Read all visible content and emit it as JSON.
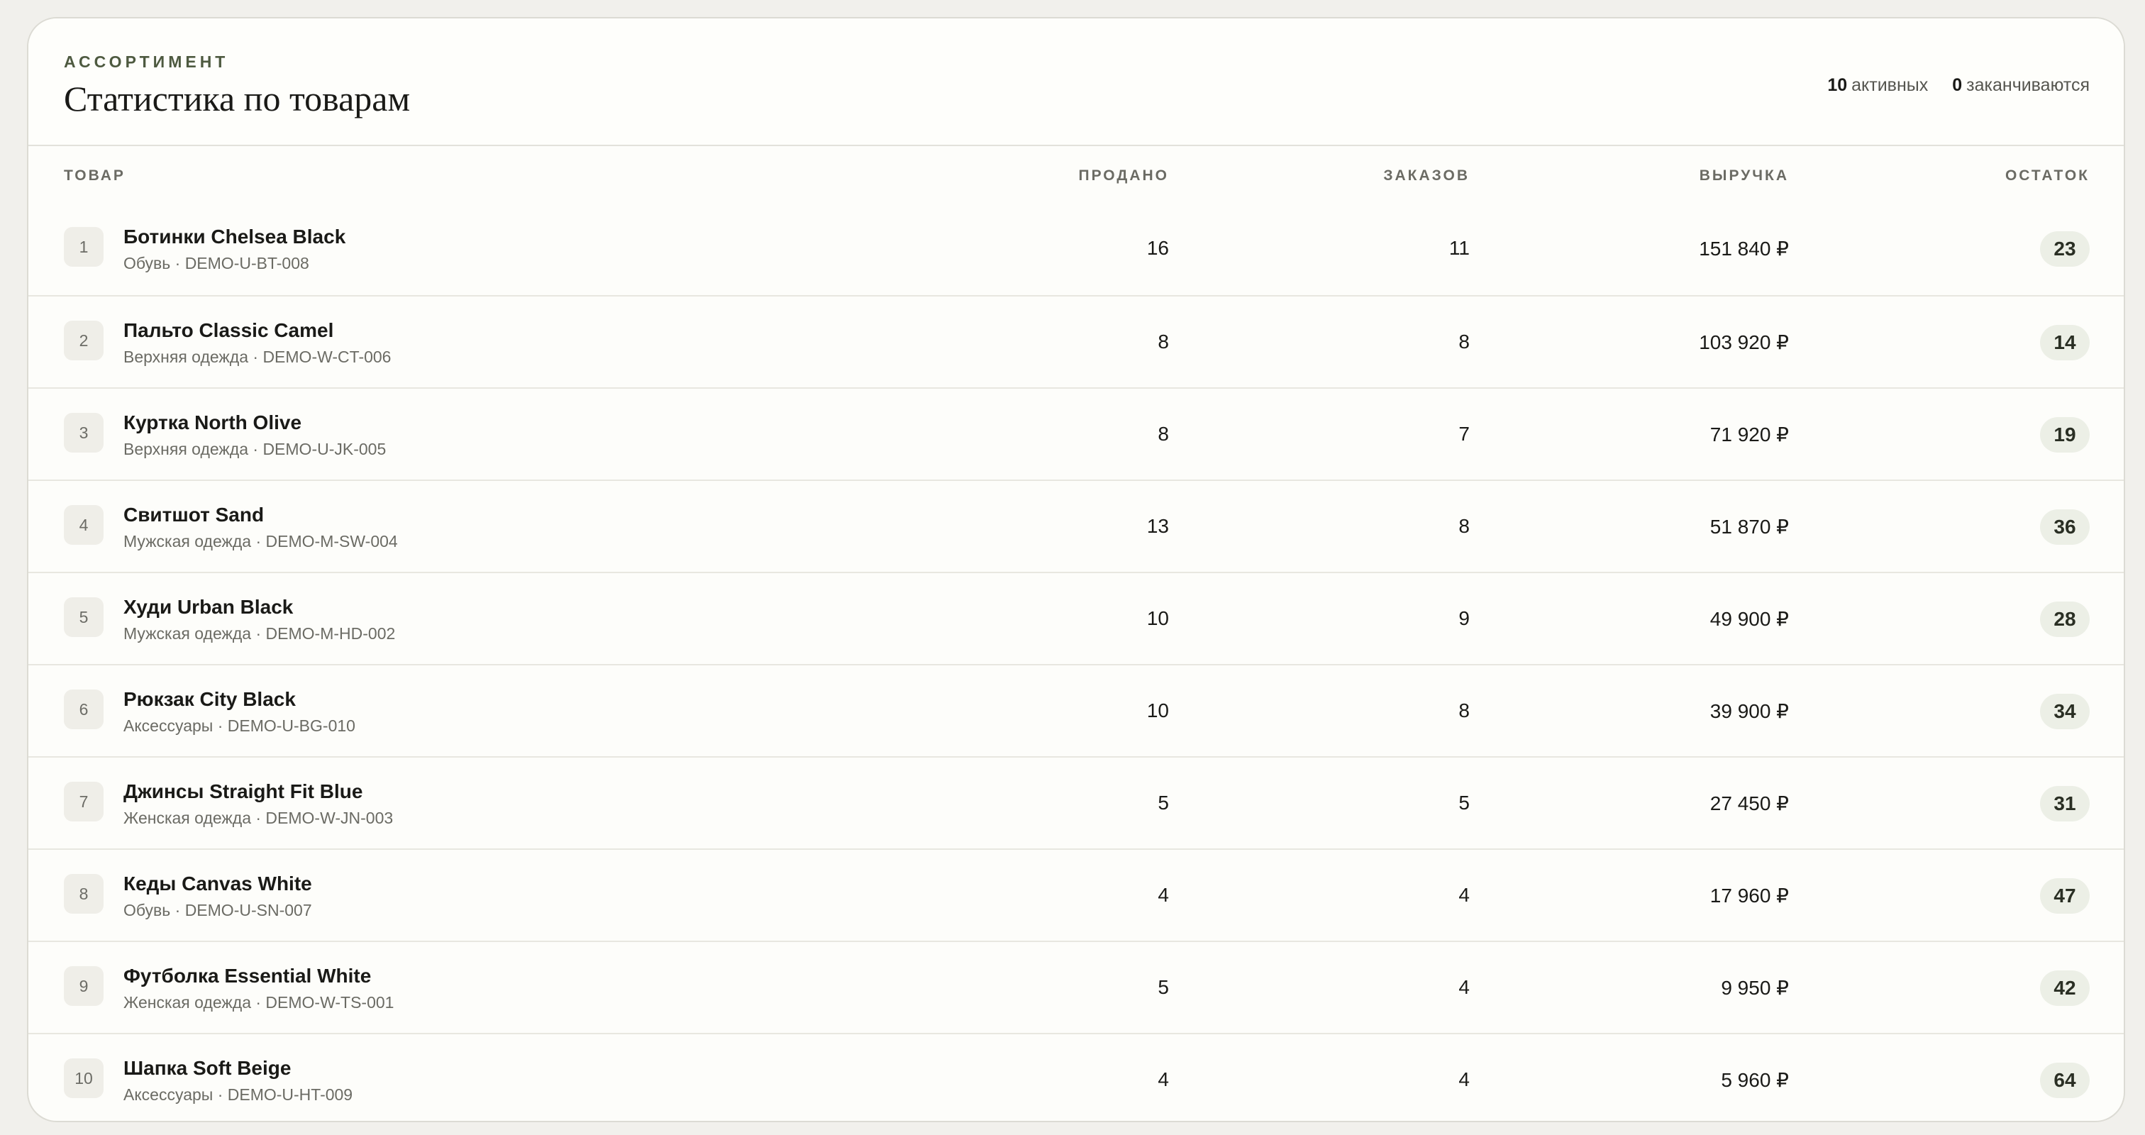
{
  "header": {
    "eyebrow": "АССОРТИМЕНТ",
    "title": "Статистика по товарам",
    "active_count": "10",
    "active_label": "активных",
    "low_count": "0",
    "low_label": "заканчиваются"
  },
  "columns": {
    "product": "ТОВАР",
    "sold": "ПРОДАНО",
    "orders": "ЗАКАЗОВ",
    "revenue": "ВЫРУЧКА",
    "stock": "ОСТАТОК"
  },
  "rows": [
    {
      "rank": "1",
      "name": "Ботинки Chelsea Black",
      "meta": "Обувь · DEMO-U-BT-008",
      "sold": "16",
      "orders": "11",
      "revenue": "151 840 ₽",
      "stock": "23"
    },
    {
      "rank": "2",
      "name": "Пальто Classic Camel",
      "meta": "Верхняя одежда · DEMO-W-CT-006",
      "sold": "8",
      "orders": "8",
      "revenue": "103 920 ₽",
      "stock": "14"
    },
    {
      "rank": "3",
      "name": "Куртка North Olive",
      "meta": "Верхняя одежда · DEMO-U-JK-005",
      "sold": "8",
      "orders": "7",
      "revenue": "71 920 ₽",
      "stock": "19"
    },
    {
      "rank": "4",
      "name": "Свитшот Sand",
      "meta": "Мужская одежда · DEMO-M-SW-004",
      "sold": "13",
      "orders": "8",
      "revenue": "51 870 ₽",
      "stock": "36"
    },
    {
      "rank": "5",
      "name": "Худи Urban Black",
      "meta": "Мужская одежда · DEMO-M-HD-002",
      "sold": "10",
      "orders": "9",
      "revenue": "49 900 ₽",
      "stock": "28"
    },
    {
      "rank": "6",
      "name": "Рюкзак City Black",
      "meta": "Аксессуары · DEMO-U-BG-010",
      "sold": "10",
      "orders": "8",
      "revenue": "39 900 ₽",
      "stock": "34"
    },
    {
      "rank": "7",
      "name": "Джинсы Straight Fit Blue",
      "meta": "Женская одежда · DEMO-W-JN-003",
      "sold": "5",
      "orders": "5",
      "revenue": "27 450 ₽",
      "stock": "31"
    },
    {
      "rank": "8",
      "name": "Кеды Canvas White",
      "meta": "Обувь · DEMO-U-SN-007",
      "sold": "4",
      "orders": "4",
      "revenue": "17 960 ₽",
      "stock": "47"
    },
    {
      "rank": "9",
      "name": "Футболка Essential White",
      "meta": "Женская одежда · DEMO-W-TS-001",
      "sold": "5",
      "orders": "4",
      "revenue": "9 950 ₽",
      "stock": "42"
    },
    {
      "rank": "10",
      "name": "Шапка Soft Beige",
      "meta": "Аксессуары · DEMO-U-HT-009",
      "sold": "4",
      "orders": "4",
      "revenue": "5 960 ₽",
      "stock": "64"
    }
  ]
}
